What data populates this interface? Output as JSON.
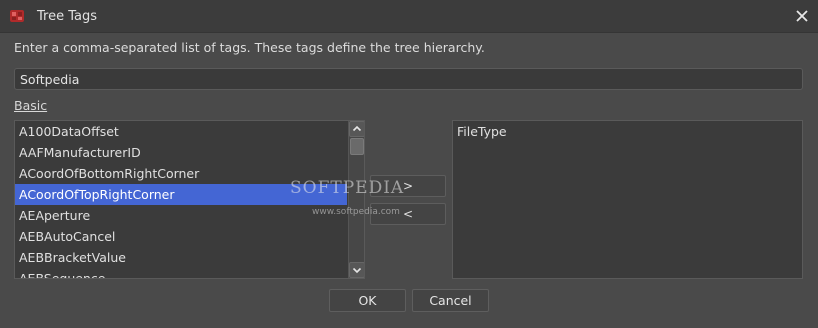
{
  "window": {
    "title": "Tree Tags",
    "icon": "app-icon",
    "close_icon": "close-icon"
  },
  "instructions": "Enter a comma-separated list of tags. These tags define the tree hierarchy.",
  "tags_input": {
    "value": "Softpedia"
  },
  "section_label": "Basic",
  "available_list": {
    "items": [
      "A100DataOffset",
      "AAFManufacturerID",
      "ACoordOfBottomRightCorner",
      "ACoordOfTopRightCorner",
      "AEAperture",
      "AEBAutoCancel",
      "AEBBracketValue",
      "AEBSequence"
    ],
    "selected_index": 3
  },
  "move_buttons": {
    "add_label": ">",
    "remove_label": "<"
  },
  "selected_list": {
    "items": [
      "FileType"
    ]
  },
  "watermark": {
    "text": "SOFTPEDIA",
    "sub": "www.softpedia.com"
  },
  "buttons": {
    "ok": "OK",
    "cancel": "Cancel"
  },
  "colors": {
    "background": "#4a4a4a",
    "selection": "#4466d4",
    "text": "#e6e6e6"
  }
}
